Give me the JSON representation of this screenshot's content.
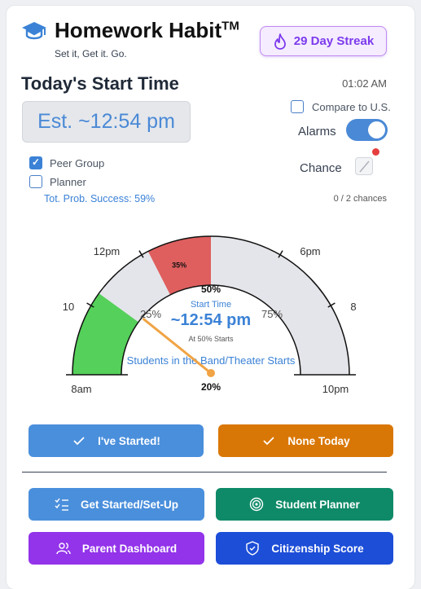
{
  "app": {
    "title": "Homework Habit",
    "trademark": "TM",
    "tagline": "Set it, Get it. Go.",
    "brand_color": "#3b82d6"
  },
  "streak": {
    "label": "29 Day Streak",
    "color": "#7c3aed",
    "icon": "flame-icon"
  },
  "start": {
    "heading": "Today's Start Time",
    "estimate": "Est. ~12:54 pm",
    "clock": "01:02 AM"
  },
  "options": {
    "peer_group": {
      "label": "Peer Group",
      "checked": true
    },
    "planner": {
      "label": "Planner",
      "checked": false
    },
    "compare": {
      "label": "Compare to U.S.",
      "checked": false
    },
    "alarms": {
      "label": "Alarms",
      "on": true
    },
    "chance": {
      "label": "Chance"
    },
    "probability": "Tot. Prob. Success: 59%",
    "chances_count": "0 / 2 chances"
  },
  "gauge": {
    "tick_labels": [
      "8am",
      "10",
      "12pm",
      "6pm",
      "8",
      "10pm"
    ],
    "segment_35": "35%",
    "pct_50": "50%",
    "pct_25": "25%",
    "pct_75": "75%",
    "start_time_label": "Start Time",
    "start_time_value": "~12:54 pm",
    "at_50": "At 50% Starts",
    "band_label": "Students in the Band/Theater Starts",
    "pct_20": "20%",
    "green_fraction": 0.2,
    "red_start_fraction": 0.35,
    "red_end_fraction": 0.5,
    "needle_fraction": 0.2,
    "colors": {
      "green": "#55d05a",
      "red": "#df5f5f",
      "track": "#e4e5ea",
      "needle": "#f0a445"
    }
  },
  "actions": {
    "started": {
      "label": "I've Started!",
      "color": "#4a8fdc",
      "icon": "check-icon"
    },
    "none_today": {
      "label": "None Today",
      "color": "#d97706",
      "icon": "check-icon"
    },
    "setup": {
      "label": "Get Started/Set-Up",
      "color": "#4a8fdc",
      "icon": "checklist-icon"
    },
    "planner": {
      "label": "Student Planner",
      "color": "#0f8a68",
      "icon": "target-icon"
    },
    "parent": {
      "label": "Parent Dashboard",
      "color": "#9333ea",
      "icon": "users-icon"
    },
    "citizenship": {
      "label": "Citizenship Score",
      "color": "#1d4ed8",
      "icon": "shield-icon"
    }
  }
}
